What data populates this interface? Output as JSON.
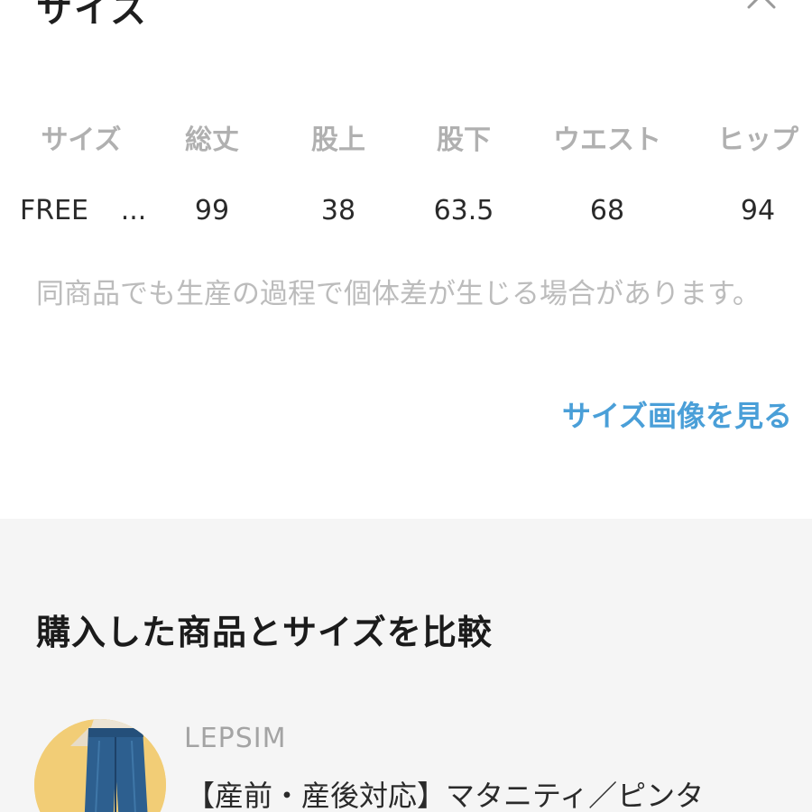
{
  "header": {
    "title": "サイズ"
  },
  "size_table": {
    "headers": [
      "サイズ",
      "総丈",
      "股上",
      "股下",
      "ウエスト",
      "ヒップ"
    ],
    "row": {
      "size": "FREE",
      "ellipsis": "...",
      "values": [
        "99",
        "38",
        "63.5",
        "68",
        "94"
      ]
    }
  },
  "note": "同商品でも生産の過程で個体差が生じる場合があります。",
  "view_image_link": "サイズ画像を見る",
  "compare": {
    "heading": "購入した商品とサイズを比較",
    "product": {
      "brand": "LEPSIM",
      "name": "【産前・産後対応】マタニティ／ピンタ"
    }
  }
}
